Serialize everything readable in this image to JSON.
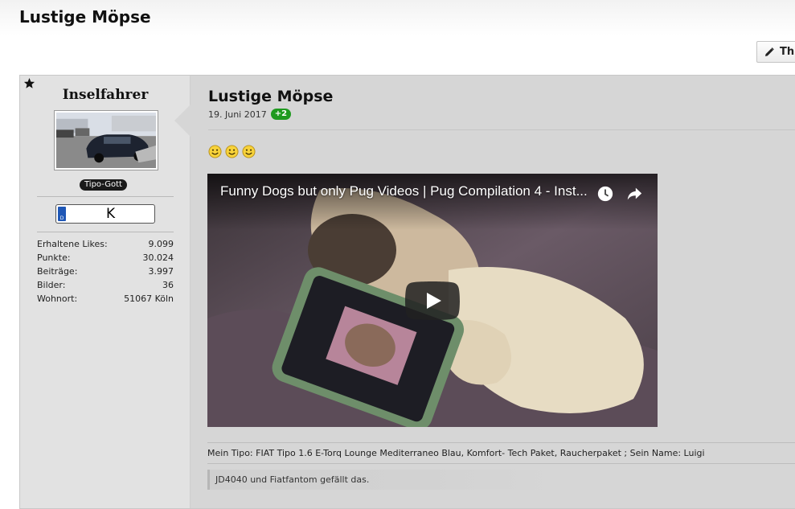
{
  "page": {
    "title": "Lustige Möpse"
  },
  "toolbar": {
    "thread_button_label": "Th"
  },
  "author": {
    "name": "Inselfahrer",
    "rank": "Tipo-Gott",
    "plate": {
      "country": "D",
      "text": "K"
    },
    "stats": [
      {
        "label": "Erhaltene Likes:",
        "value": "9.099"
      },
      {
        "label": "Punkte:",
        "value": "30.024"
      },
      {
        "label": "Beiträge:",
        "value": "3.997"
      },
      {
        "label": "Bilder:",
        "value": "36"
      },
      {
        "label": "Wohnort:",
        "value": "51067 Köln"
      }
    ]
  },
  "post": {
    "title": "Lustige Möpse",
    "date": "19. Juni 2017",
    "like_count": "+2",
    "smiley_count": 3,
    "video": {
      "title": "Funny Dogs but only Pug Videos | Pug Compilation 4 - Inst..."
    },
    "signature": "Mein Tipo: FIAT Tipo 1.6 E-Torq Lounge Mediterraneo Blau, Komfort- Tech Paket, Raucherpaket ; Sein Name: Luigi",
    "likes_text": "JD4040 und Fiatfantom gefällt das."
  },
  "colors": {
    "like_badge": "#1f9a1f",
    "rank_badge": "#1a1a1a",
    "play_button": "#212121"
  }
}
